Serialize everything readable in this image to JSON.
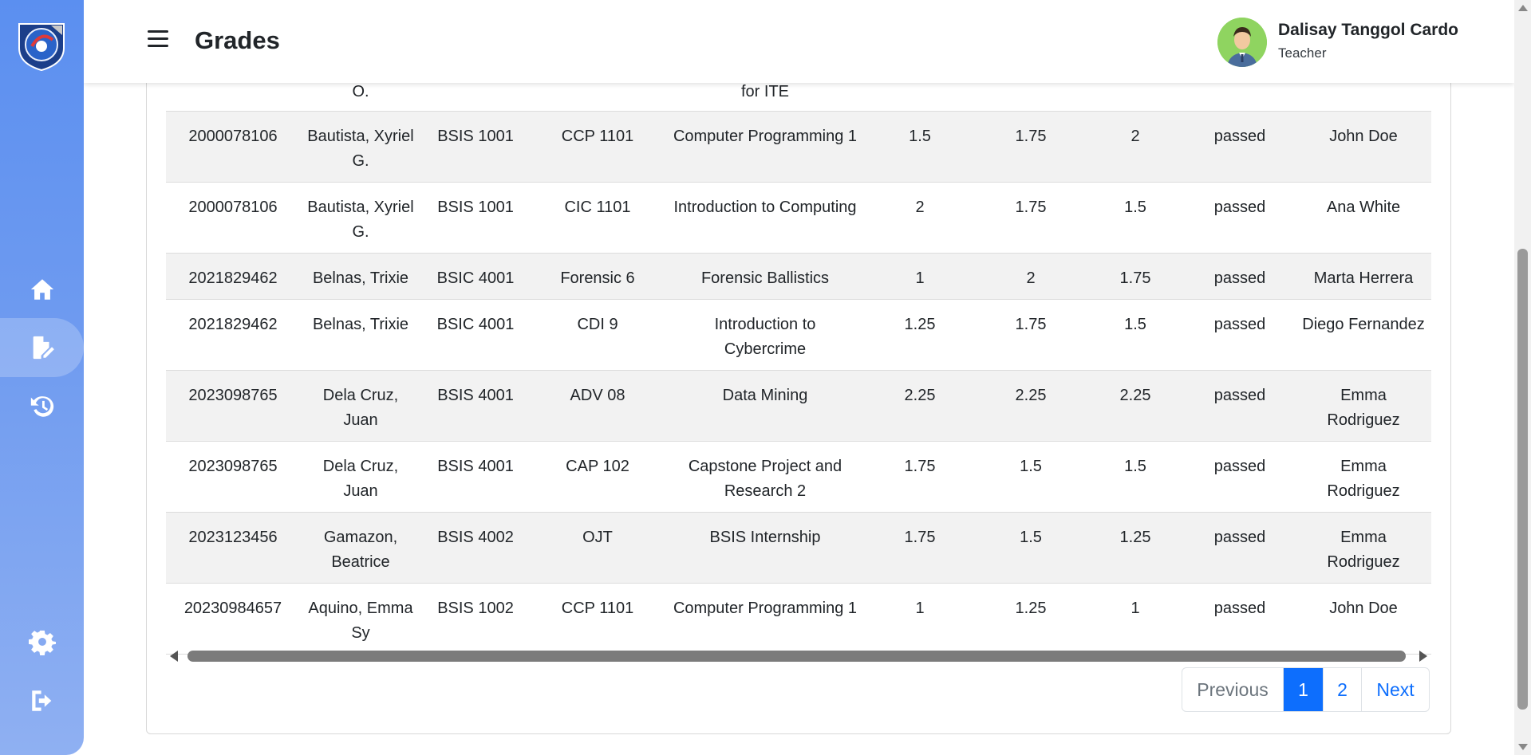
{
  "header": {
    "title": "Grades",
    "user_name": "Dalisay Tanggol Cardo",
    "user_role": "Teacher"
  },
  "sidebar": {
    "items": [
      {
        "icon": "home-icon"
      },
      {
        "icon": "file-edit-icon",
        "active": true
      },
      {
        "icon": "history-icon"
      },
      {
        "icon": "gear-icon"
      },
      {
        "icon": "logout-icon"
      }
    ]
  },
  "table": {
    "partial_row": [
      "O.",
      "for ITE"
    ],
    "rows": [
      {
        "student_no": "2000078106",
        "name": "Bautista, Xyriel G.",
        "program": "BSIS 1001",
        "code": "CCP 1101",
        "subject": "Computer Programming 1",
        "g1": "1.5",
        "g2": "1.75",
        "g3": "2",
        "status": "passed",
        "instructor": "John Doe"
      },
      {
        "student_no": "2000078106",
        "name": "Bautista, Xyriel G.",
        "program": "BSIS 1001",
        "code": "CIC 1101",
        "subject": "Introduction to Computing",
        "g1": "2",
        "g2": "1.75",
        "g3": "1.5",
        "status": "passed",
        "instructor": "Ana White"
      },
      {
        "student_no": "2021829462",
        "name": "Belnas, Trixie",
        "program": "BSIC 4001",
        "code": "Forensic 6",
        "subject": "Forensic Ballistics",
        "g1": "1",
        "g2": "2",
        "g3": "1.75",
        "status": "passed",
        "instructor": "Marta Herrera"
      },
      {
        "student_no": "2021829462",
        "name": "Belnas, Trixie",
        "program": "BSIC 4001",
        "code": "CDI 9",
        "subject": "Introduction to Cybercrime",
        "g1": "1.25",
        "g2": "1.75",
        "g3": "1.5",
        "status": "passed",
        "instructor": "Diego Fernandez"
      },
      {
        "student_no": "2023098765",
        "name": "Dela Cruz, Juan",
        "program": "BSIS 4001",
        "code": "ADV 08",
        "subject": "Data Mining",
        "g1": "2.25",
        "g2": "2.25",
        "g3": "2.25",
        "status": "passed",
        "instructor": "Emma Rodriguez"
      },
      {
        "student_no": "2023098765",
        "name": "Dela Cruz, Juan",
        "program": "BSIS 4001",
        "code": "CAP 102",
        "subject": "Capstone Project and Research 2",
        "g1": "1.75",
        "g2": "1.5",
        "g3": "1.5",
        "status": "passed",
        "instructor": "Emma Rodriguez"
      },
      {
        "student_no": "2023123456",
        "name": "Gamazon, Beatrice",
        "program": "BSIS 4002",
        "code": "OJT",
        "subject": "BSIS Internship",
        "g1": "1.75",
        "g2": "1.5",
        "g3": "1.25",
        "status": "passed",
        "instructor": "Emma Rodriguez"
      },
      {
        "student_no": "20230984657",
        "name": "Aquino, Emma Sy",
        "program": "BSIS 1002",
        "code": "CCP 1101",
        "subject": "Computer Programming 1",
        "g1": "1",
        "g2": "1.25",
        "g3": "1",
        "status": "passed",
        "instructor": "John Doe"
      }
    ]
  },
  "pagination": {
    "previous": "Previous",
    "page1": "1",
    "page2": "2",
    "next": "Next"
  },
  "colors": {
    "accent": "#0d6efd",
    "sidebar_top": "#5b8ff0",
    "sidebar_bottom": "#8fb0f2",
    "stripe": "#f2f2f2"
  }
}
